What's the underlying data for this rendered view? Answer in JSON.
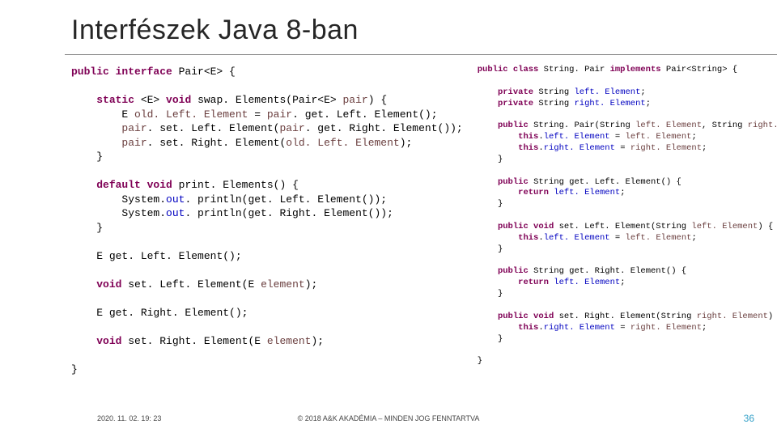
{
  "title": "Interfészek Java 8-ban",
  "code_left": {
    "l01a": "public interface",
    "l01b": " Pair<E> {",
    "l03a": "static",
    "l03b": " <E> ",
    "l03c": "void",
    "l03d": " swap. Elements(Pair<E> ",
    "l03e": "pair",
    "l03f": ") {",
    "l04a": "E ",
    "l04b": "old. Left. Element",
    "l04c": " = ",
    "l04d": "pair",
    "l04e": ". get. Left. Element();",
    "l05a": "pair",
    "l05b": ". set. Left. Element(",
    "l05c": "pair",
    "l05d": ". get. Right. Element());",
    "l06a": "pair",
    "l06b": ". set. Right. Element(",
    "l06c": "old. Left. Element",
    "l06d": ");",
    "l07": "}",
    "l09a": "default void",
    "l09b": " print. Elements() {",
    "l10a": "System.",
    "l10b": "out",
    "l10c": ". println(get. Left. Element());",
    "l11a": "System.",
    "l11b": "out",
    "l11c": ". println(get. Right. Element());",
    "l12": "}",
    "l14": "E get. Left. Element();",
    "l16a": "void",
    "l16b": " set. Left. Element(E ",
    "l16c": "element",
    "l16d": ");",
    "l18": "E get. Right. Element();",
    "l20a": "void",
    "l20b": " set. Right. Element(E ",
    "l20c": "element",
    "l20d": ");",
    "l22": "}"
  },
  "code_right": {
    "r01a": "public class",
    "r01b": " String. Pair ",
    "r01c": "implements",
    "r01d": " Pair<String> {",
    "r03a": "private",
    "r03b": " String ",
    "r03c": "left. Element",
    "r03d": ";",
    "r04a": "private",
    "r04b": " String ",
    "r04c": "right. Element",
    "r04d": ";",
    "r06a": "public",
    "r06b": " String. Pair(String ",
    "r06c": "left. Element",
    "r06d": ", String ",
    "r06e": "right. Element",
    "r06f": ") {",
    "r07a": "this",
    "r07b": ".",
    "r07c": "left. Element",
    "r07d": " = ",
    "r07e": "left. Element",
    "r07f": ";",
    "r08a": "this",
    "r08b": ".",
    "r08c": "right. Element",
    "r08d": " = ",
    "r08e": "right. Element",
    "r08f": ";",
    "r09": "}",
    "r11a": "public",
    "r11b": " String get. Left. Element() {",
    "r12a": "return",
    "r12b": " ",
    "r12c": "left. Element",
    "r12d": ";",
    "r13": "}",
    "r15a": "public void",
    "r15b": " set. Left. Element(String ",
    "r15c": "left. Element",
    "r15d": ") {",
    "r16a": "this",
    "r16b": ".",
    "r16c": "left. Element",
    "r16d": " = ",
    "r16e": "left. Element",
    "r16f": ";",
    "r17": "}",
    "r19a": "public",
    "r19b": " String get. Right. Element() {",
    "r20a": "return",
    "r20b": " ",
    "r20c": "left. Element",
    "r20d": ";",
    "r21": "}",
    "r23a": "public void",
    "r23b": " set. Right. Element(String ",
    "r23c": "right. Element",
    "r23d": ") {",
    "r24a": "this",
    "r24b": ".",
    "r24c": "right. Element",
    "r24d": " = ",
    "r24e": "right. Element",
    "r24f": ";",
    "r25": "}",
    "r27": "}"
  },
  "footer": {
    "timestamp": "2020. 11. 02. 19: 23",
    "copyright": "© 2018 A&K AKADÉMIA – MINDEN JOG FENNTARTVA",
    "page": "36"
  }
}
